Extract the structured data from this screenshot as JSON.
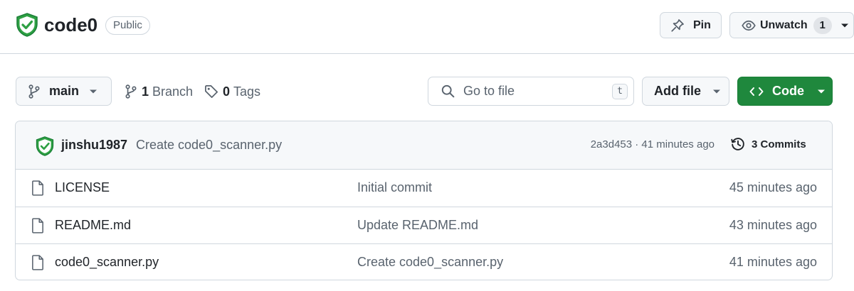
{
  "repo": {
    "name": "code0",
    "visibility": "Public"
  },
  "actions": {
    "pin_label": "Pin",
    "watch_label": "Unwatch",
    "watch_count": "1"
  },
  "toolbar": {
    "branch": "main",
    "branch_count": "1",
    "branch_word": "Branch",
    "tag_count": "0",
    "tag_word": "Tags",
    "search_placeholder": "Go to file",
    "search_shortcut": "t",
    "add_file_label": "Add file",
    "code_label": "Code"
  },
  "latest_commit": {
    "author": "jinshu1987",
    "message": "Create code0_scanner.py",
    "sha_age": "2a3d453 · 41 minutes ago",
    "commits_label": "3 Commits"
  },
  "files": [
    {
      "name": "LICENSE",
      "commit": "Initial commit",
      "age": "45 minutes ago"
    },
    {
      "name": "README.md",
      "commit": "Update README.md",
      "age": "43 minutes ago"
    },
    {
      "name": "code0_scanner.py",
      "commit": "Create code0_scanner.py",
      "age": "41 minutes ago"
    }
  ],
  "colors": {
    "code_button": "#1f883d",
    "shield_green": "#2ea043",
    "border": "#d0d7de",
    "muted_text": "#59636e"
  },
  "icons": {
    "avatar": "green-shield-check-icon",
    "pin": "pin-icon",
    "watch": "eye-icon",
    "branch": "git-branch-icon",
    "tag": "tag-icon",
    "search": "search-icon",
    "code": "code-brackets-icon",
    "history": "history-clock-icon",
    "file": "file-icon"
  }
}
